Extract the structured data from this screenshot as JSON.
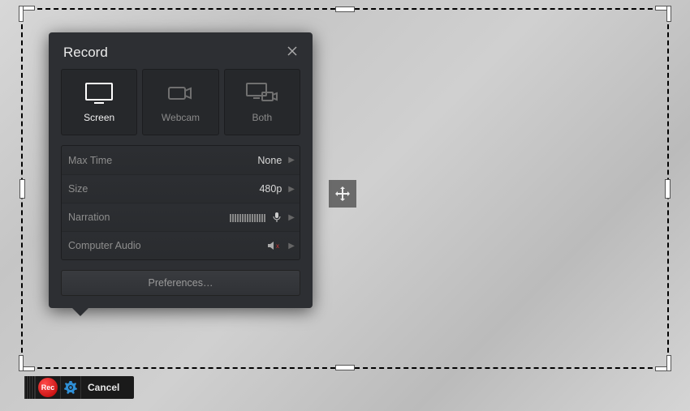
{
  "panel": {
    "title": "Record",
    "sources": [
      {
        "label": "Screen",
        "active": true
      },
      {
        "label": "Webcam",
        "active": false
      },
      {
        "label": "Both",
        "active": false
      }
    ],
    "settings": {
      "max_time": {
        "label": "Max Time",
        "value": "None"
      },
      "size": {
        "label": "Size",
        "value": "480p"
      },
      "narration": {
        "label": "Narration"
      },
      "computer_audio": {
        "label": "Computer Audio",
        "muted": true
      }
    },
    "preferences_label": "Preferences…"
  },
  "toolbar": {
    "rec_label": "Rec",
    "cancel_label": "Cancel"
  }
}
